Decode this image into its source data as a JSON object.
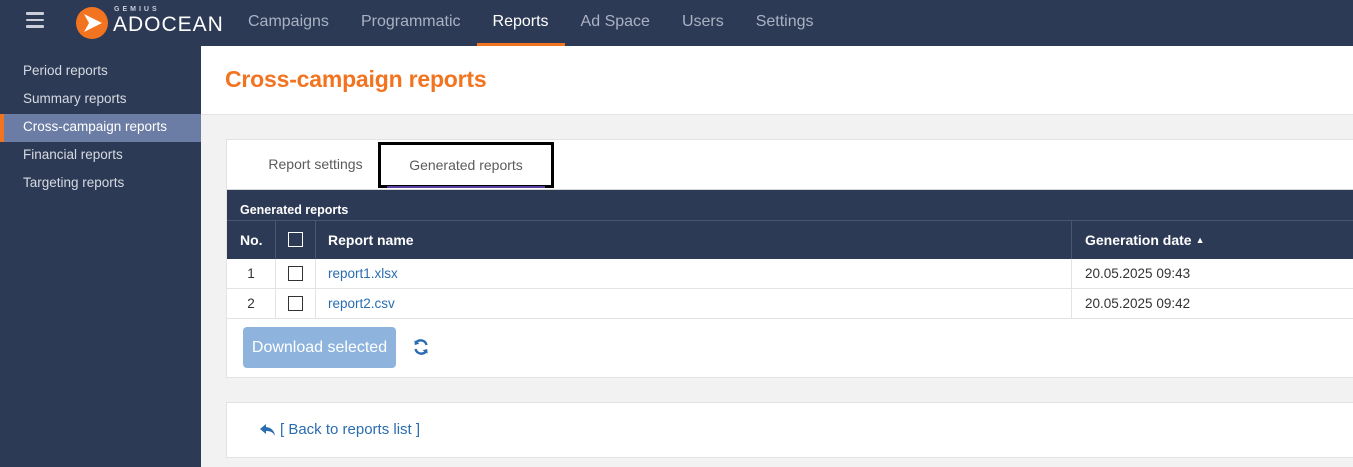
{
  "brand": {
    "small": "GEMIUS",
    "name": "ADOCEAN",
    "accent": "#f27420"
  },
  "nav": {
    "items": [
      {
        "label": "Campaigns"
      },
      {
        "label": "Programmatic"
      },
      {
        "label": "Reports",
        "active": true
      },
      {
        "label": "Ad Space"
      },
      {
        "label": "Users"
      },
      {
        "label": "Settings"
      }
    ]
  },
  "sidebar": {
    "items": [
      {
        "label": "Period reports"
      },
      {
        "label": "Summary reports"
      },
      {
        "label": "Cross-campaign reports",
        "active": true
      },
      {
        "label": "Financial reports"
      },
      {
        "label": "Targeting reports"
      }
    ]
  },
  "page": {
    "title": "Cross-campaign reports"
  },
  "tabs": [
    {
      "label": "Report settings"
    },
    {
      "label": "Generated reports",
      "active": true
    }
  ],
  "table": {
    "caption": "Generated reports",
    "headers": {
      "no": "No.",
      "name": "Report name",
      "date": "Generation date"
    },
    "rows": [
      {
        "no": "1",
        "name": "report1.xlsx",
        "date": "20.05.2025 09:43"
      },
      {
        "no": "2",
        "name": "report2.csv",
        "date": "20.05.2025 09:42"
      }
    ]
  },
  "actions": {
    "download": "Download selected"
  },
  "back": {
    "label": "[ Back to reports list ]"
  }
}
